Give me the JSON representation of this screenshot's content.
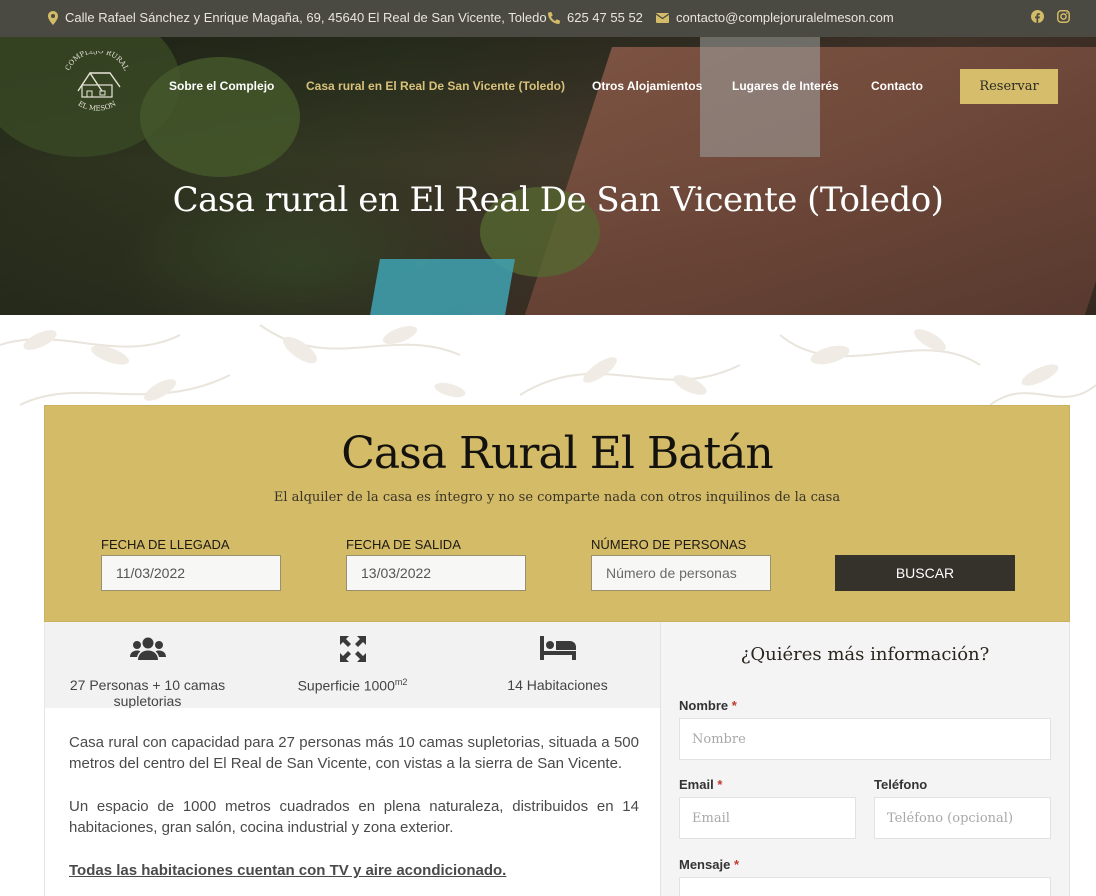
{
  "topbar": {
    "address": "Calle Rafael Sánchez y Enrique Magaña, 69, 45640 El Real de San Vicente, Toledo",
    "phone": "625 47 55 52",
    "email": "contacto@complejoruralelmeson.com",
    "icons": [
      "map-pin-icon",
      "phone-icon",
      "envelope-icon",
      "facebook-icon",
      "instagram-icon"
    ]
  },
  "logo": {
    "line1": "COMPLEJO RURAL",
    "line2": "EL MESON"
  },
  "nav": {
    "items": [
      {
        "label": "Sobre el Complejo"
      },
      {
        "label": "Casa rural en El Real De San Vicente (Toledo)"
      },
      {
        "label": "Otros Alojamientos"
      },
      {
        "label": "Lugares de Interés"
      },
      {
        "label": "Contacto"
      }
    ],
    "active_index": 1,
    "reserve_label": "Reservar"
  },
  "hero": {
    "title": "Casa rural en El Real De San Vicente (Toledo)"
  },
  "booking": {
    "title": "Casa Rural El Batán",
    "subtitle": "El alquiler de la casa es íntegro y no se comparte nada con otros inquilinos de la casa",
    "arrival_label": "FECHA DE LLEGADA",
    "arrival_value": "11/03/2022",
    "departure_label": "FECHA DE SALIDA",
    "departure_value": "13/03/2022",
    "people_label": "NÚMERO DE PERSONAS",
    "people_placeholder": "Número de personas",
    "search_label": "BUSCAR"
  },
  "features": [
    {
      "icon": "users-icon",
      "text": "27 Personas + 10 camas supletorias"
    },
    {
      "icon": "expand-arrows-icon",
      "text": "Superficie 1000",
      "sup": "m2"
    },
    {
      "icon": "bed-icon",
      "text": "14 Habitaciones"
    }
  ],
  "description": {
    "p1": "Casa rural con capacidad para 27 personas más 10 camas supletorias, situada a 500 metros del centro del El Real de San Vicente, con vistas a la sierra de San Vicente.",
    "p2": "Un espacio de 1000 metros cuadrados en plena naturaleza, distribuidos en 14 habitaciones, gran salón, cocina industrial y zona exterior.",
    "p3": "Todas las habitaciones cuentan con TV y aire acondicionado."
  },
  "form": {
    "title": "¿Quiéres más información?",
    "name_label": "Nombre",
    "name_placeholder": "Nombre",
    "email_label": "Email",
    "email_placeholder": "Email",
    "phone_label": "Teléfono",
    "phone_placeholder": "Teléfono (opcional)",
    "message_label": "Mensaje",
    "required_mark": "*"
  },
  "colors": {
    "topbar": "#4a4942",
    "gold": "#d3bb68",
    "dark_button": "#35322c",
    "nav_active": "#d8c17a"
  }
}
